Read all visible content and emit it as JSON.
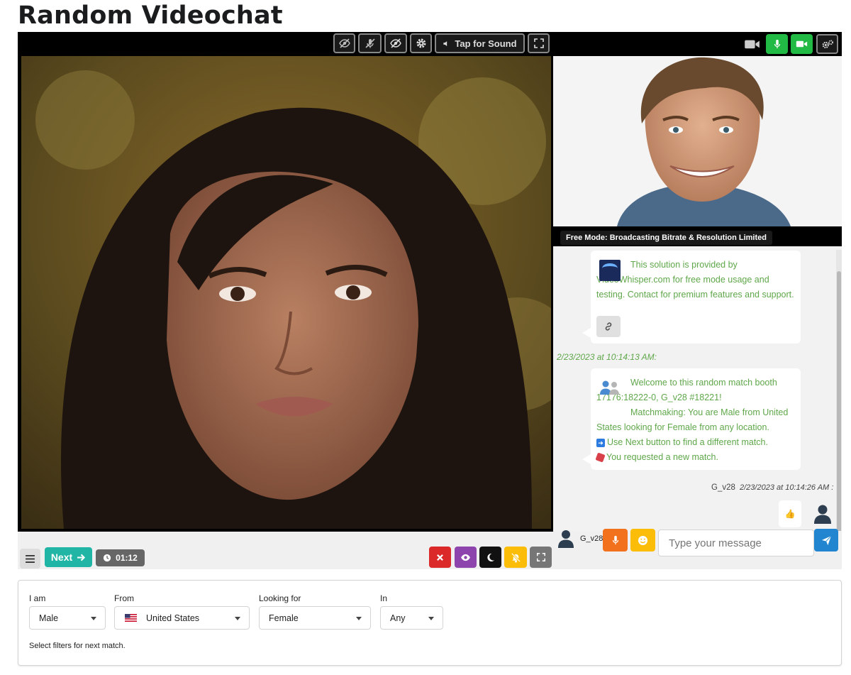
{
  "page": {
    "title": "Random Videochat"
  },
  "toolbar": {
    "sound_label": "Tap for Sound",
    "icons": [
      "eye-slash-icon",
      "mic-slash-icon",
      "eye-slash-icon",
      "gear-icon",
      "volume-icon",
      "fullscreen-icon"
    ],
    "right_icons": [
      "camera-icon",
      "microphone-icon",
      "video-icon",
      "settings-icon"
    ]
  },
  "self_video": {
    "badge": "Free Mode: Broadcasting Bitrate & Resolution Limited"
  },
  "chat": {
    "message1": {
      "text": "This solution is provided by VideoWhisper.com for free mode usage and testing. Contact for premium features and support.",
      "logo_text": "VideoWhisper"
    },
    "timestamp1": "2/23/2023 at 10:14:13 AM:",
    "message2": {
      "line1": "Welcome to this random match booth 17176:18222-0, G_v28 #18221!",
      "line2": "Matchmaking: You are Male from United States looking for Female from any location.",
      "line3": "Use Next button to find a different match.",
      "line4": "You requested a new match."
    },
    "sender": "G_v28",
    "timestamp2": "2/23/2023 at 10:14:26 AM :",
    "reaction": "👍",
    "input_user": "G_v28",
    "input_placeholder": "Type your message"
  },
  "controls": {
    "next_label": "Next",
    "timer": "01:12",
    "colors": {
      "next": "#21b5a6",
      "timer": "#666666",
      "close": "#db2828",
      "eye": "#8e44ad",
      "moon": "#111111",
      "bell": "#fbbd08",
      "fullscreen": "#767676"
    }
  },
  "filters": {
    "i_am": {
      "label": "I am",
      "value": "Male"
    },
    "from": {
      "label": "From",
      "value": "United States"
    },
    "looking_for": {
      "label": "Looking for",
      "value": "Female"
    },
    "in": {
      "label": "In",
      "value": "Any"
    },
    "hint": "Select filters for next match."
  }
}
